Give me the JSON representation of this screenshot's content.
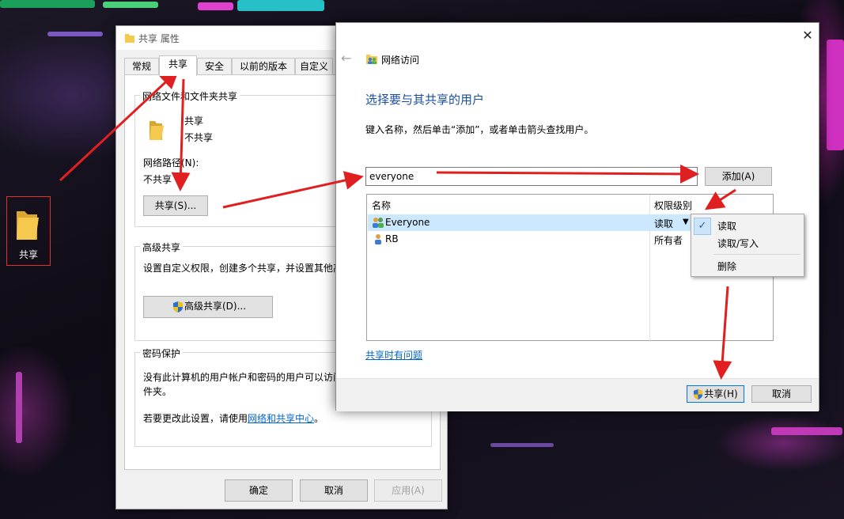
{
  "desktop": {
    "folder_label": "共享"
  },
  "properties": {
    "title": "共享 属性",
    "tabs": [
      "常规",
      "共享",
      "安全",
      "以前的版本",
      "自定义"
    ],
    "network_group_title": "网络文件和文件夹共享",
    "item_name": "共享",
    "item_status": "不共享",
    "network_path_label": "网络路径(N):",
    "network_path_value": "不共享",
    "share_button": "共享(S)...",
    "advanced_group_title": "高级共享",
    "advanced_desc": "设置自定义权限，创建多个共享，并设置其他高",
    "advanced_button": "高级共享(D)...",
    "password_group_title": "密码保护",
    "password_desc_line1": "没有此计算机的用户帐户和密码的用户可以访问",
    "password_desc_line2": "件夹。",
    "password_change_prefix": "若要更改此设置，请使用",
    "password_change_link": "网络和共享中心",
    "password_change_suffix": "。",
    "ok_button": "确定",
    "cancel_button": "取消",
    "apply_button": "应用(A)"
  },
  "network_access": {
    "title": "网络访问",
    "heading": "选择要与其共享的用户",
    "instruction": "键入名称，然后单击“添加”，或者单击箭头查找用户。",
    "input_value": "everyone",
    "add_button": "添加(A)",
    "columns": {
      "name": "名称",
      "permission": "权限级别"
    },
    "rows": [
      {
        "name": "Everyone",
        "permission": "读取"
      },
      {
        "name": "RB",
        "permission": "所有者"
      }
    ],
    "help_link": "共享时有问题",
    "share_button": "共享(H)",
    "cancel_button": "取消"
  },
  "permission_menu": {
    "items": [
      "读取",
      "读取/写入",
      "删除"
    ],
    "checked": "读取"
  },
  "colors": {
    "accent": "#0078d7",
    "heading": "#1a4fa0",
    "link": "#0066cc",
    "selection": "#cce8ff",
    "annotation_arrow": "#e02020"
  },
  "icons": {
    "back": "back-arrow-icon",
    "shield": "uac-shield-icon",
    "close": "close-icon",
    "folder": "folder-icon",
    "users": "users-group-icon",
    "user": "user-icon",
    "check": "checkmark-icon",
    "dropdown": "dropdown-caret-icon"
  }
}
